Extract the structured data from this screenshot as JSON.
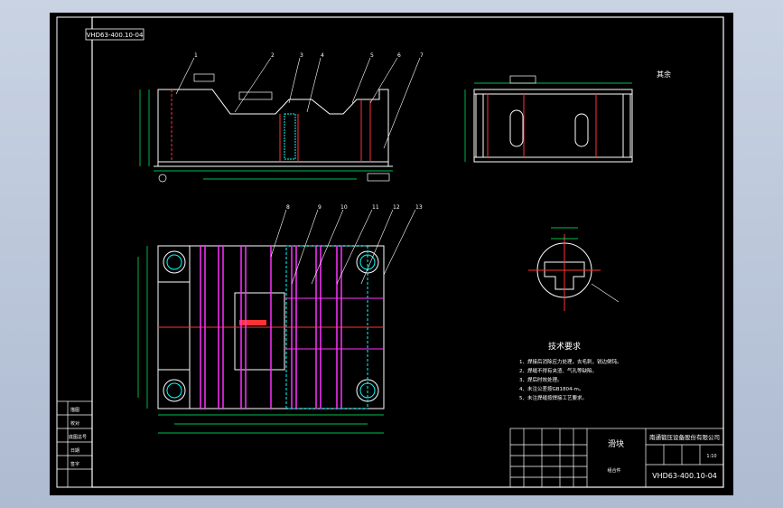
{
  "drawing": {
    "drawing_code": "VHD63-400.10-04",
    "part_name": "滑块",
    "company": "南通锻压设备股份有限公司",
    "rotated_code": "VHD63-400.10-04",
    "note_top_right": "其余",
    "scale": "1:10",
    "material": "组合件",
    "tech_req_title": "技术要求",
    "tech_req_items": [
      "1、焊接后消除应力处理，去毛刺，锐边倒钝。",
      "2、焊缝不得有夹渣、气孔等缺陷。",
      "3、焊后时效处理。",
      "4、未注公差按GB1804-m。",
      "5、未注焊缝按焊接工艺要求。"
    ],
    "left_side_labels": [
      "描图",
      "校对",
      "底图总号",
      "日期",
      "签字"
    ],
    "balloons_top": [
      "1",
      "2",
      "3",
      "4",
      "5",
      "6",
      "7"
    ],
    "balloons_plan": [
      "8",
      "9",
      "10",
      "11",
      "12",
      "13"
    ],
    "colors": {
      "line": "#ffffff",
      "hidden": "#00ffff",
      "center": "#ff3333",
      "weld": "#ff33ff",
      "dim": "#00ff66"
    }
  }
}
